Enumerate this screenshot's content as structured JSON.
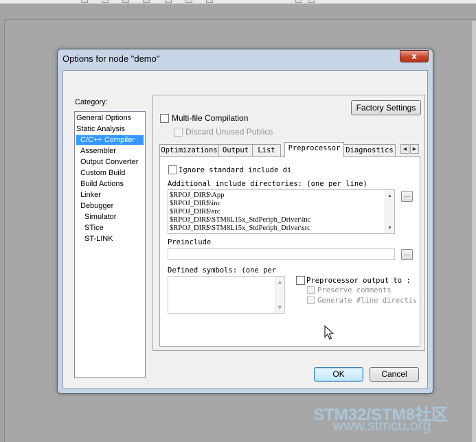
{
  "dialog": {
    "title": "Options for node \"demo\"",
    "close_glyph": "x"
  },
  "category": {
    "label": "Category:",
    "items": [
      "General Options",
      "Static Analysis",
      "C/C++ Compiler",
      "Assembler",
      "Output Converter",
      "Custom Build",
      "Build Actions",
      "Linker",
      "Debugger",
      "Simulator",
      "STice",
      "ST-LINK"
    ],
    "selected": "C/C++ Compiler"
  },
  "panel": {
    "factory_settings": "Factory Settings",
    "multi_file": "Multi-file Compilation",
    "discard_unused": "Discard Unused Publics"
  },
  "tabs": [
    "Optimizations",
    "Output",
    "List",
    "Preprocessor",
    "Diagnostics"
  ],
  "active_tab": "Preprocessor",
  "preprocessor": {
    "ignore_std": "Ignore standard include direc",
    "include_label": "Additional include directories: (one per line)",
    "include_dirs": [
      "$RPOJ_DIR$\\App",
      "$RPOJ_DIR$\\inc",
      "$RPOJ_DIR$\\src",
      "$RPOJ_DIR$\\STM8L15x_StdPeriph_Driver\\inc",
      "$RPOJ_DIR$\\STM8L15x_StdPeriph_Driver\\src"
    ],
    "preinclude_label": "Preinclude",
    "preinclude_value": "",
    "defined_label": "Defined symbols: (one per",
    "pp_output": "Preprocessor output to :",
    "preserve_comments": "Preserve comments",
    "generate_line": "Generate #line directive",
    "browse_glyph": "..."
  },
  "buttons": {
    "ok": "OK",
    "cancel": "Cancel"
  },
  "watermark": {
    "brand": "STM32/STM8社区",
    "url": "www.stmcu.org"
  }
}
